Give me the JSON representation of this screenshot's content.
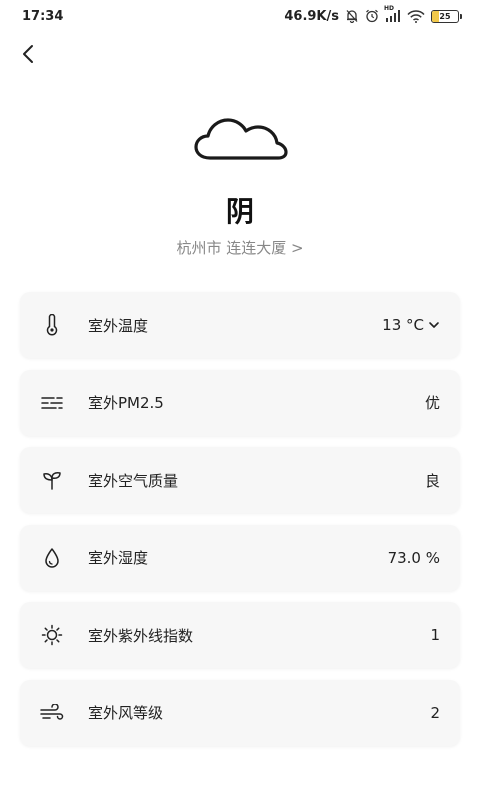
{
  "status_bar": {
    "time": "17:34",
    "network_speed": "46.9K/s",
    "signal_badge": "HD",
    "battery_level": "25",
    "battery_fraction": 0.25,
    "battery_color": "#f2c94c"
  },
  "header": {
    "back_icon": "chevron-left-icon"
  },
  "weather": {
    "icon": "cloud-icon",
    "condition": "阴",
    "location": "杭州市 连连大厦 >"
  },
  "metrics": [
    {
      "icon": "thermometer-icon",
      "label": "室外温度",
      "value": "13 °C",
      "has_dropdown": true
    },
    {
      "icon": "pm25-icon",
      "label": "室外PM2.5",
      "value": "优"
    },
    {
      "icon": "sprout-icon",
      "label": "室外空气质量",
      "value": "良"
    },
    {
      "icon": "droplet-icon",
      "label": "室外湿度",
      "value": "73.0 %"
    },
    {
      "icon": "sun-icon",
      "label": "室外紫外线指数",
      "value": "1"
    },
    {
      "icon": "wind-icon",
      "label": "室外风等级",
      "value": "2"
    }
  ]
}
